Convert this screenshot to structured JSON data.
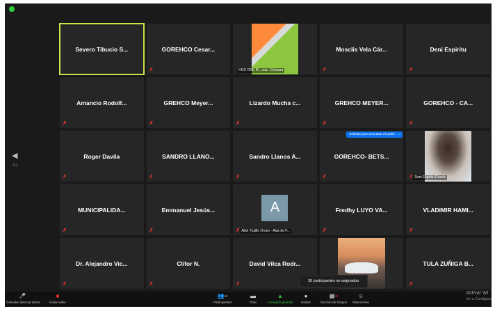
{
  "sidebar": {
    "prev_arrow": "◀",
    "page_indicator": "1/2"
  },
  "tiles": [
    {
      "name": "Severo Tibucio S...",
      "muted": false,
      "active": true
    },
    {
      "name": "GOREHCO Cesar...",
      "muted": true
    },
    {
      "name": "",
      "video": "map",
      "caption": "HCO DRE M ...ma.. Cchuara",
      "muted": false
    },
    {
      "name": "Mosclis Vela Cár...",
      "muted": true
    },
    {
      "name": "Deni Espiritu",
      "muted": true
    },
    {
      "name": "Amancio Rodolf...",
      "muted": true
    },
    {
      "name": "GREHCO Meyer...",
      "muted": true
    },
    {
      "name": "Lizardo Mucha c...",
      "muted": true
    },
    {
      "name": "GREHCO MEYER...",
      "muted": true
    },
    {
      "name": "GOREHCO - CA...",
      "muted": true
    },
    {
      "name": "Roger Davila",
      "muted": true
    },
    {
      "name": "SANDRO LLANO...",
      "muted": true
    },
    {
      "name": "Sandro Llanos A...",
      "muted": true
    },
    {
      "name": "GOREHCO- BETS...",
      "muted": true
    },
    {
      "name": "",
      "video": "photo",
      "caption": "Deni Espiritu Rueda",
      "muted": true
    },
    {
      "name": "MUNICIPALIDA...",
      "muted": true
    },
    {
      "name": "Emmanuel Jesús...",
      "muted": true
    },
    {
      "name": "",
      "video": "avatar",
      "avatar_letter": "A",
      "caption": "Abel Trujillo Oroso - Alas de F...",
      "muted": true
    },
    {
      "name": "Fredhy LUYO VA...",
      "muted": true
    },
    {
      "name": "VLADIMIR HAMI...",
      "muted": true
    },
    {
      "name": "Dr. Alejandro Vic...",
      "muted": true
    },
    {
      "name": "Clifor N.",
      "muted": true
    },
    {
      "name": "David Vilca Rodr...",
      "muted": true
    },
    {
      "name": "",
      "video": "car",
      "muted": false
    },
    {
      "name": "TULA ZUÑIGA B...",
      "muted": true
    }
  ],
  "audio_request": {
    "label": "Solicitar para reactivar el audio",
    "more": "..."
  },
  "tooltip": {
    "text": "30 participantes no asignados"
  },
  "toolbar": {
    "mute": {
      "label": "Cancelar silenciar ahora",
      "icon": "🎤"
    },
    "video": {
      "label": "Iniciar video",
      "icon": "■"
    },
    "participants": {
      "label": "Participantes",
      "icon": "👥",
      "count": "32"
    },
    "chat": {
      "label": "Chat",
      "icon": "▬"
    },
    "share": {
      "label": "Compartir pantalla",
      "icon": "▲"
    },
    "record": {
      "label": "Grabar",
      "icon": "●"
    },
    "breakout": {
      "label": "Sección de Grupos",
      "icon": "▦",
      "badge": "30"
    },
    "reactions": {
      "label": "Reacciones",
      "icon": "☺"
    }
  },
  "activate": {
    "title": "Activar Wi",
    "subtitle": "Ve a Configura"
  },
  "colors": {
    "active_border": "#c9e34b",
    "mute_red": "#e0352b",
    "accent_blue": "#0e72ed",
    "share_green": "#2ecc40"
  }
}
